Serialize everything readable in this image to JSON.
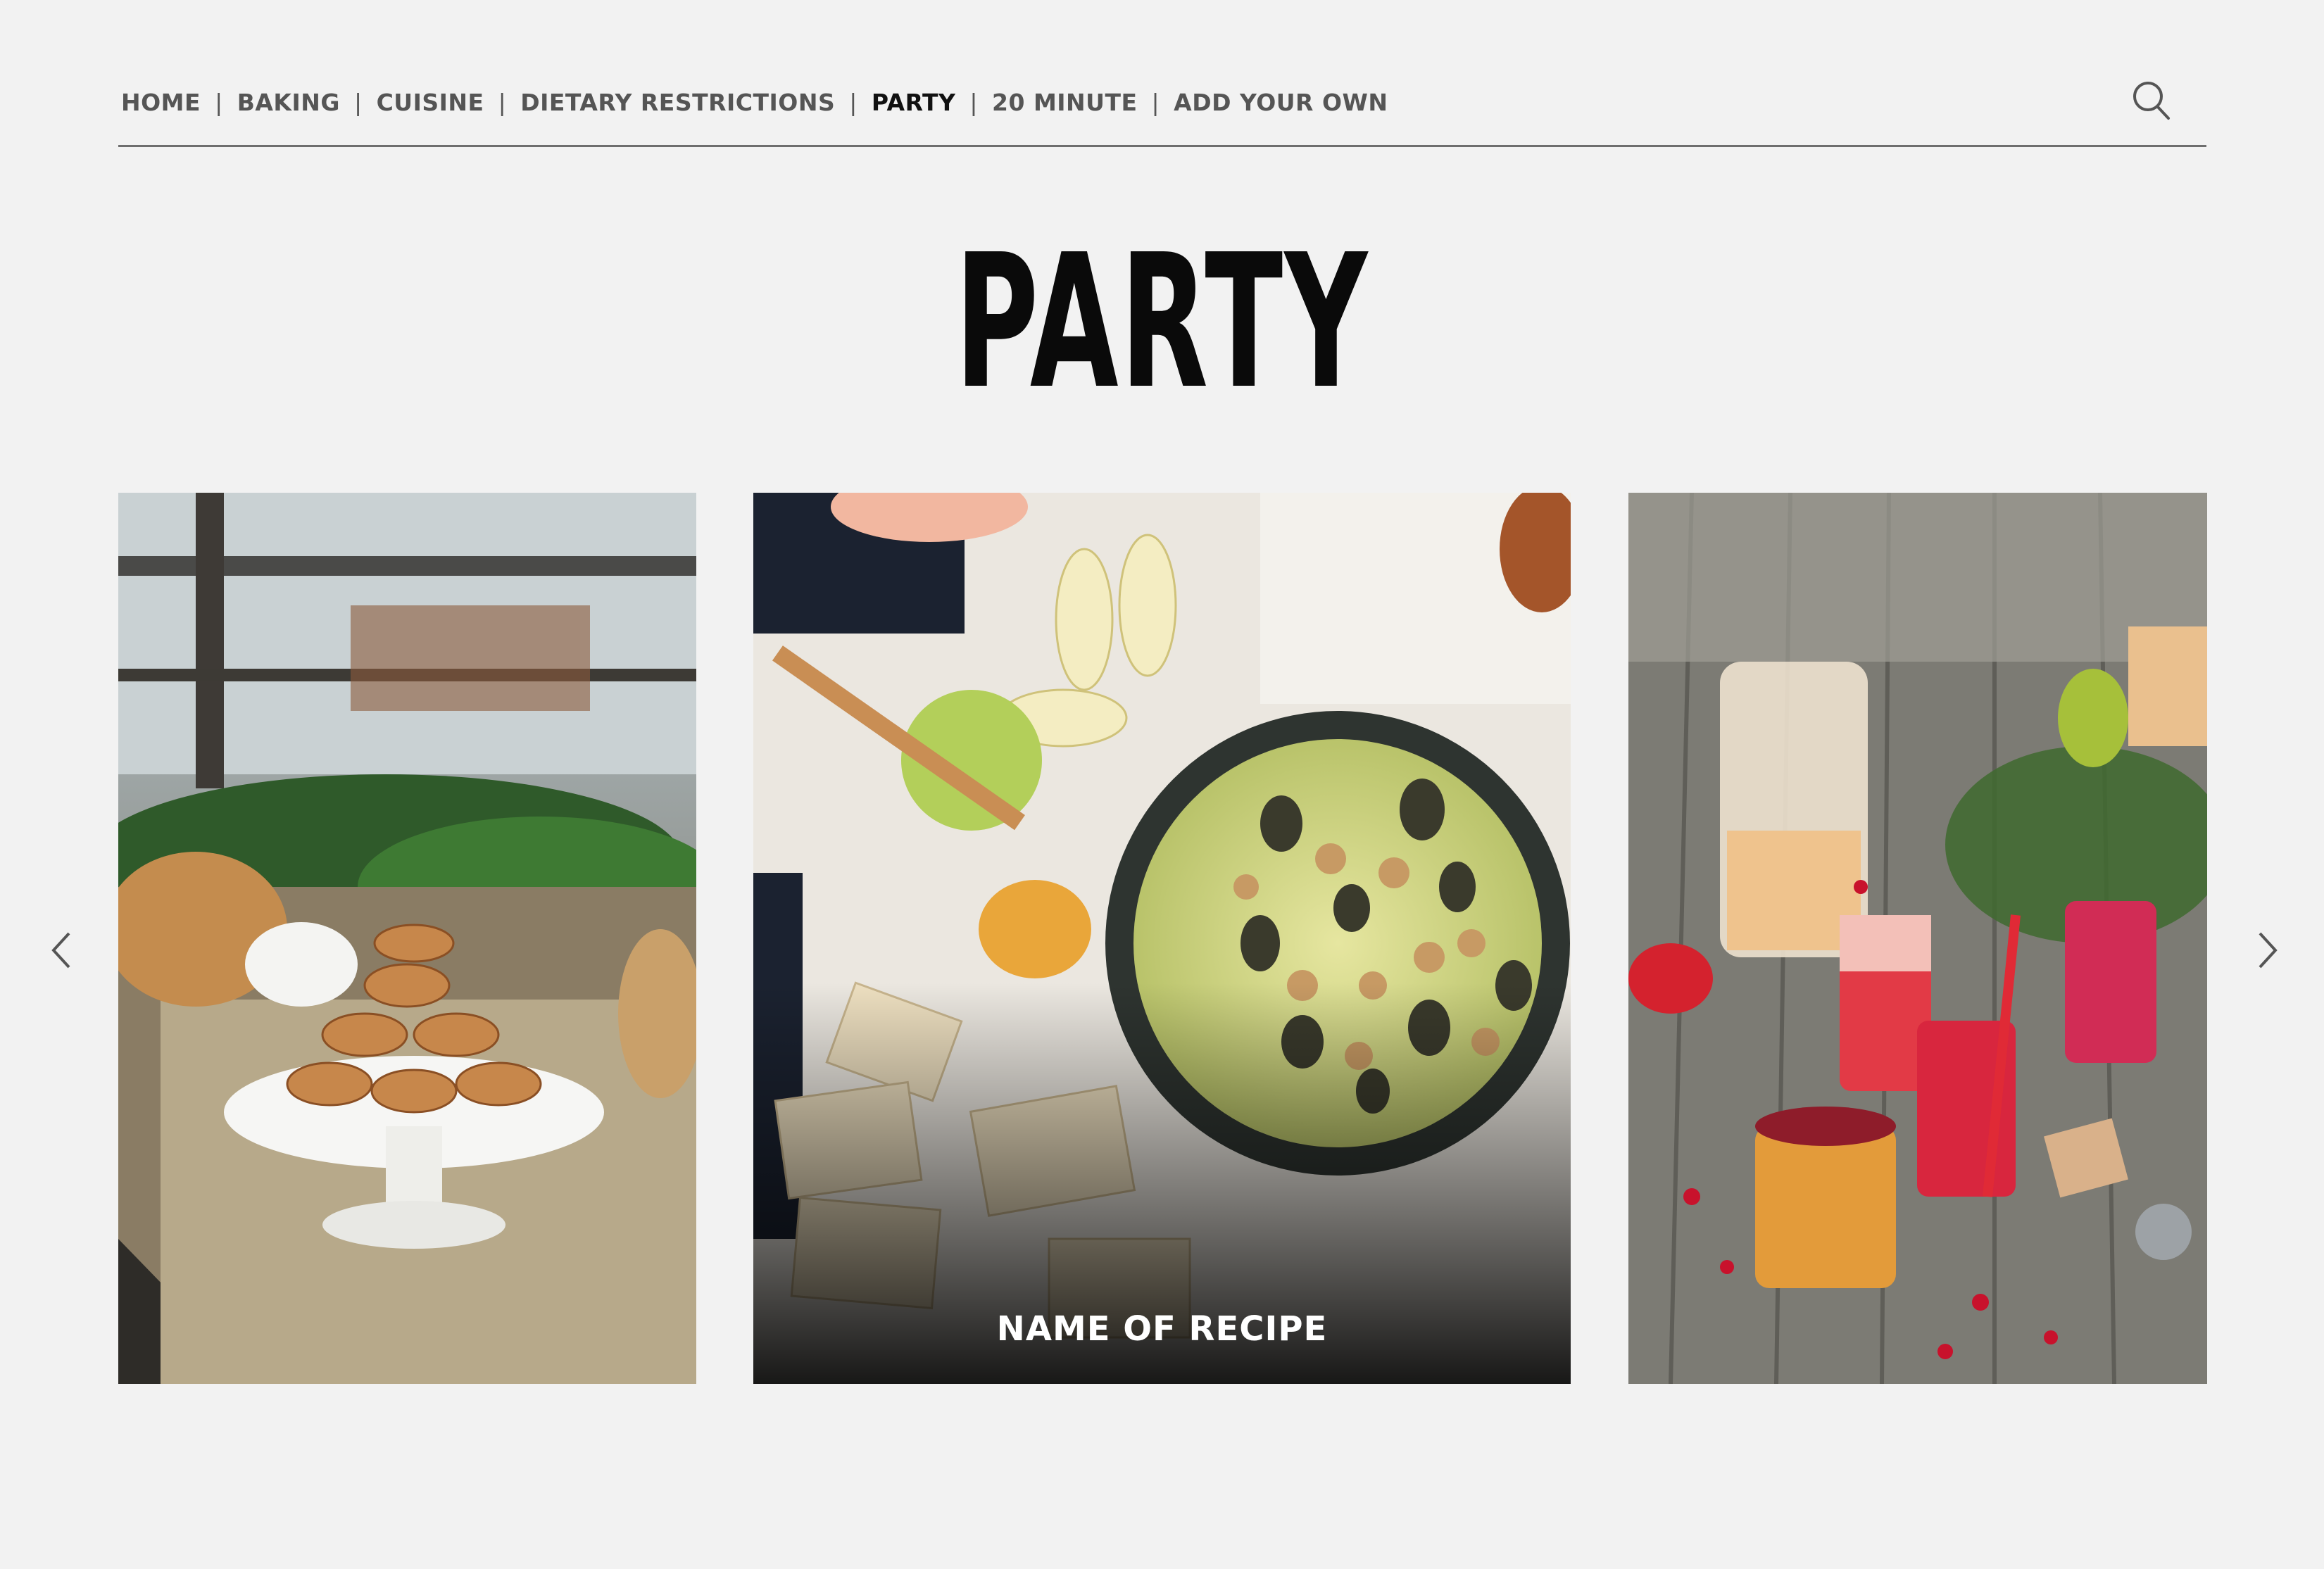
{
  "nav": {
    "items": [
      {
        "label": "HOME",
        "active": false
      },
      {
        "label": "BAKING",
        "active": false
      },
      {
        "label": "CUISINE",
        "active": false
      },
      {
        "label": "DIETARY RESTRICTIONS",
        "active": false
      },
      {
        "label": "PARTY",
        "active": true
      },
      {
        "label": "20 MINUTE",
        "active": false
      },
      {
        "label": "ADD YOUR OWN",
        "active": false
      }
    ],
    "separator": "|"
  },
  "search": {
    "icon": "search-icon"
  },
  "page": {
    "title": "PARTY"
  },
  "carousel": {
    "prev_icon": "chevron-left-icon",
    "next_icon": "chevron-right-icon",
    "cards": [
      {
        "name": "left-card",
        "image": "pastries-on-cake-stand"
      },
      {
        "name": "center-card",
        "image": "baked-dip-skillet",
        "caption": "NAME OF RECIPE"
      },
      {
        "name": "right-card",
        "image": "cranberry-drinks"
      }
    ]
  },
  "colors": {
    "background": "#f2f2f2",
    "nav_text": "#555555",
    "nav_active": "#111111",
    "title": "#0a0a0a"
  }
}
